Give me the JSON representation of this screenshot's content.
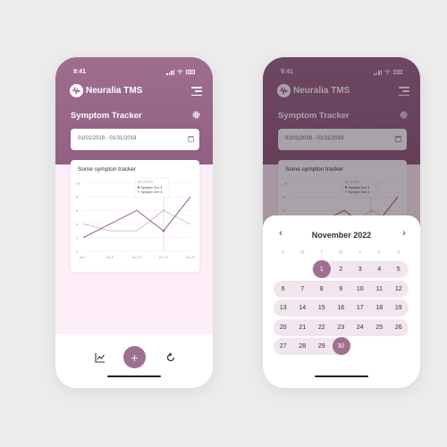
{
  "status_bar": {
    "time": "9:41"
  },
  "app": {
    "name": "Neuralia TMS"
  },
  "page": {
    "title": "Symptom Tracker"
  },
  "date_range": {
    "value": "01/01/2018 - 01/31/2018"
  },
  "card": {
    "title": "Some sympton tracker"
  },
  "chart_data": {
    "type": "line",
    "title": "",
    "xlabel": "",
    "ylabel": "",
    "ylim": [
      0,
      10
    ],
    "y_ticks": [
      "0",
      "2",
      "4",
      "6",
      "8",
      "10"
    ],
    "categories": [
      "jan 1",
      "jan 8",
      "jan 15",
      "jan 22",
      "jan 29"
    ],
    "x_tick_labels": [
      "jan 1",
      "jan 8",
      "jan 15",
      "jan 22",
      "jan 29"
    ],
    "series": [
      {
        "name": "Symptom Two",
        "color": "#8e4f72",
        "values": [
          2,
          4,
          6,
          3,
          8
        ]
      },
      {
        "name": "Symptom One",
        "color": "#c8c0c5",
        "values": [
          4,
          3,
          3,
          6,
          4
        ]
      }
    ],
    "tooltip": {
      "date": "jan 22 2024",
      "entries": [
        {
          "label": "Symptom Two: 3"
        },
        {
          "label": "Symptom One: 6"
        }
      ]
    },
    "grid": true
  },
  "bottom_nav": {
    "fab_label": "+"
  },
  "calendar": {
    "month_label": "November 2022",
    "prev_label": "‹",
    "next_label": "›",
    "weekdays": [
      "S",
      "M",
      "T",
      "W",
      "T",
      "F",
      "S"
    ],
    "weeks": [
      [
        "",
        "",
        "1",
        "2",
        "3",
        "4",
        "5"
      ],
      [
        "6",
        "7",
        "8",
        "9",
        "10",
        "11",
        "12"
      ],
      [
        "13",
        "14",
        "15",
        "16",
        "17",
        "18",
        "19"
      ],
      [
        "20",
        "21",
        "22",
        "23",
        "24",
        "25",
        "26"
      ],
      [
        "27",
        "28",
        "29",
        "30",
        "",
        "",
        ""
      ]
    ],
    "selected_days": [
      "1",
      "30"
    ]
  },
  "colors": {
    "brand": "#9b6a8d",
    "accent": "#a07092",
    "content_bg": "#fdeef7"
  },
  "icons": [
    "hamburger-menu-icon",
    "gear-icon",
    "calendar-icon",
    "chart-icon",
    "refresh-icon",
    "plus-icon"
  ]
}
